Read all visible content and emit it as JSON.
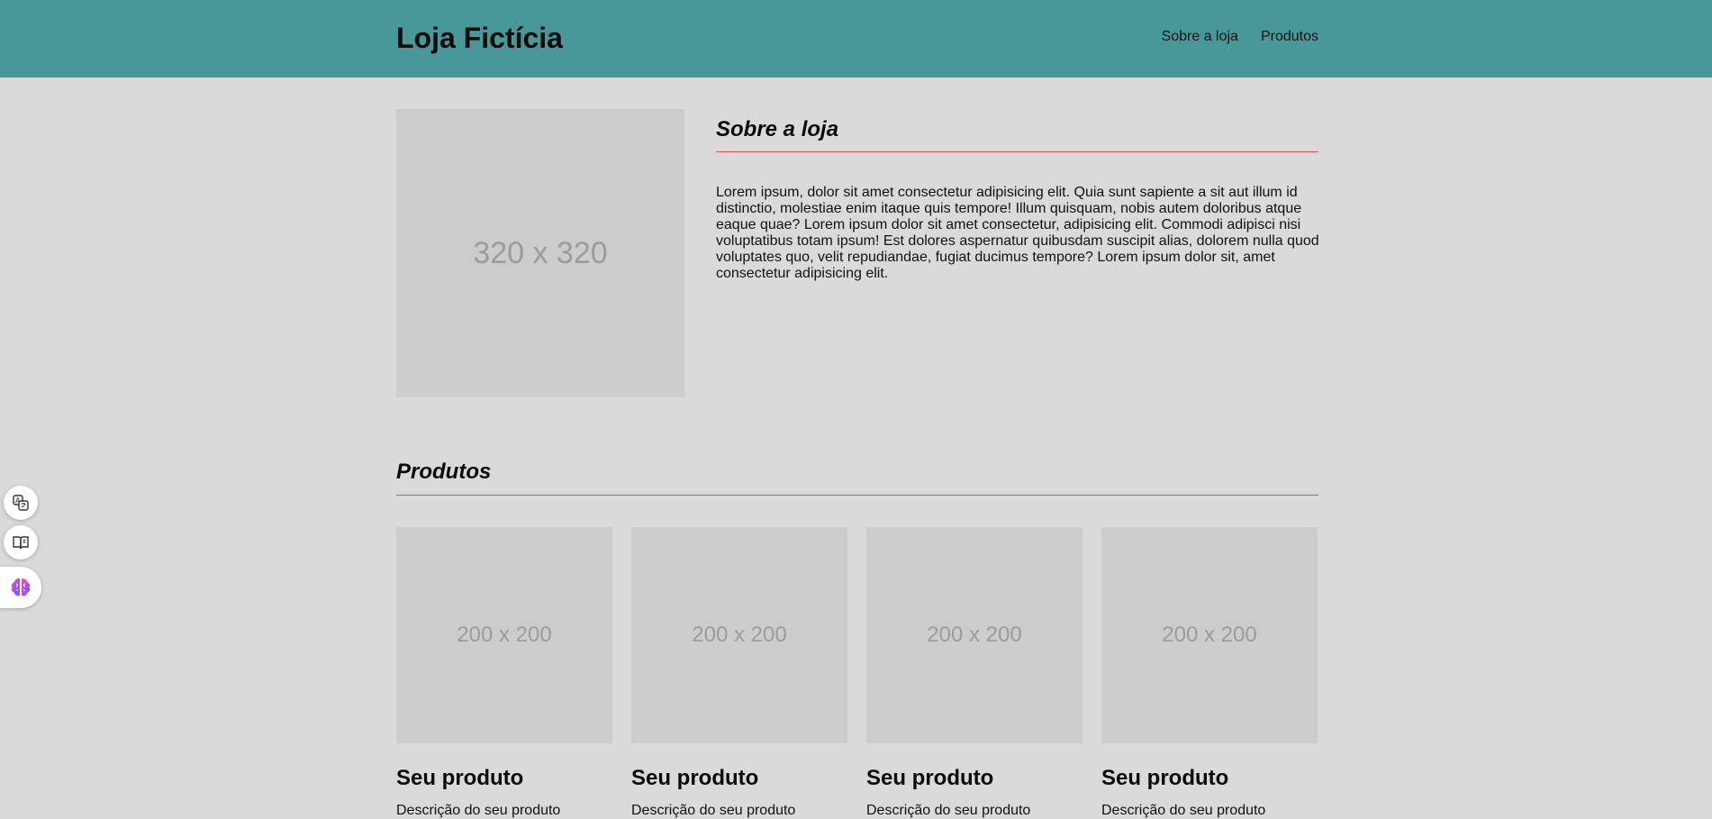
{
  "header": {
    "brand": "Loja Fictícia",
    "nav": [
      "Sobre a loja",
      "Produtos"
    ],
    "background_color": "#48989a"
  },
  "about": {
    "image_label": "320 x 320",
    "title": "Sobre a loja",
    "text": "Lorem ipsum, dolor sit amet consectetur adipisicing elit. Quia sunt sapiente a sit aut illum id distinctio, molestiae enim itaque quis tempore! Illum quisquam, nobis autem doloribus atque eaque quae? Lorem ipsum dolor sit amet consectetur, adipisicing elit. Commodi adipisci nisi voluptatibus totam ipsum! Est dolores aspernatur quibusdam suscipit alias, dolorem nulla quod voluptates quo, velit repudiandae, fugiat ducimus tempore? Lorem ipsum dolor sit, amet consectetur adipisicing elit."
  },
  "products": {
    "title": "Produtos",
    "items": [
      {
        "image_label": "200 x 200",
        "name": "Seu produto",
        "description": "Descrição do seu produto"
      },
      {
        "image_label": "200 x 200",
        "name": "Seu produto",
        "description": "Descrição do seu produto"
      },
      {
        "image_label": "200 x 200",
        "name": "Seu produto",
        "description": "Descrição do seu produto"
      },
      {
        "image_label": "200 x 200",
        "name": "Seu produto",
        "description": "Descrição do seu produto"
      }
    ]
  },
  "side_tools": {
    "icons": [
      "translate-icon",
      "reader-icon",
      "brain-icon"
    ]
  },
  "colors": {
    "page_background": "#dadada",
    "accent_rule": "#d9534f",
    "placeholder": "#cccccc"
  }
}
